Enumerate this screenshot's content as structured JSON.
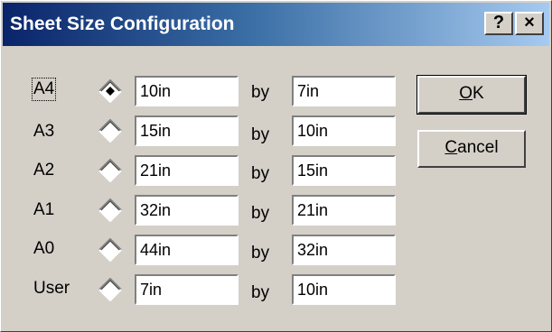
{
  "dialog": {
    "title": "Sheet Size Configuration",
    "help_button": "?",
    "close_button": "×"
  },
  "sizes": [
    {
      "label": "A4",
      "selected": true,
      "width": "10in",
      "by": "by",
      "height": "7in"
    },
    {
      "label": "A3",
      "selected": false,
      "width": "15in",
      "by": "by",
      "height": "10in"
    },
    {
      "label": "A2",
      "selected": false,
      "width": "21in",
      "by": "by",
      "height": "15in"
    },
    {
      "label": "A1",
      "selected": false,
      "width": "32in",
      "by": "by",
      "height": "21in"
    },
    {
      "label": "A0",
      "selected": false,
      "width": "44in",
      "by": "by",
      "height": "32in"
    },
    {
      "label": "User",
      "selected": false,
      "width": "7in",
      "by": "by",
      "height": "10in"
    }
  ],
  "buttons": {
    "ok_accel": "O",
    "ok_rest": "K",
    "cancel_accel": "C",
    "cancel_rest": "ancel"
  }
}
